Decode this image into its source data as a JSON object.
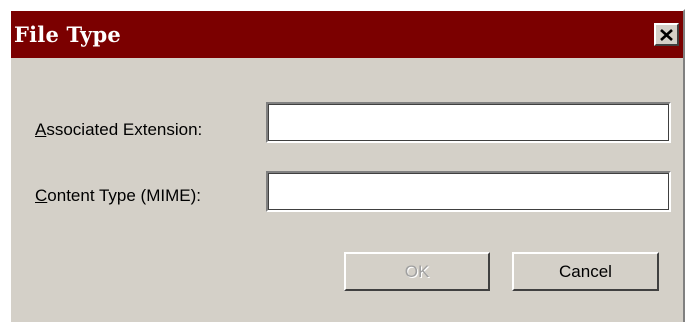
{
  "window": {
    "title": "File Type",
    "close_glyph": "✕"
  },
  "form": {
    "extension": {
      "label_accel": "A",
      "label_rest": "ssociated Extension:",
      "value": ""
    },
    "content_type": {
      "label_accel": "C",
      "label_rest": "ontent Type (MIME):",
      "value": ""
    }
  },
  "buttons": {
    "ok_label": "OK",
    "cancel_label": "Cancel"
  },
  "colors": {
    "titlebar": "#7b0000",
    "face": "#d4d0c8"
  }
}
